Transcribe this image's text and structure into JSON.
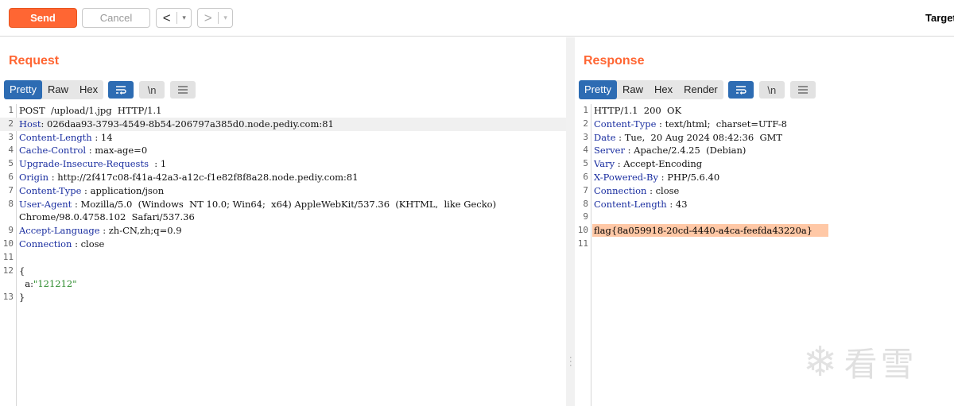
{
  "toolbar": {
    "send_label": "Send",
    "cancel_label": "Cancel",
    "back_arrow": "<",
    "forward_arrow": ">",
    "dropdown_glyph": "▾",
    "target_label": "Target"
  },
  "request": {
    "title": "Request",
    "tabs": [
      "Pretty",
      "Raw",
      "Hex"
    ],
    "active_tab": "Pretty",
    "icons": [
      "word-wrap-icon",
      "newline-icon",
      "menu-icon"
    ],
    "newline_glyph": "\\n",
    "lines": [
      {
        "num": "1",
        "segments": [
          {
            "t": "POST  /upload/1.jpg  HTTP/1.1",
            "c": "plain"
          }
        ]
      },
      {
        "num": "2",
        "highlight": true,
        "segments": [
          {
            "t": "Host",
            "c": "name"
          },
          {
            "t": ": 026daa93-3793-4549-8b54-206797a385d0.node.pediy.com:81",
            "c": "plain"
          }
        ]
      },
      {
        "num": "3",
        "segments": [
          {
            "t": "Content-Length",
            "c": "name"
          },
          {
            "t": " : 14",
            "c": "plain"
          }
        ]
      },
      {
        "num": "4",
        "segments": [
          {
            "t": "Cache-Control",
            "c": "name"
          },
          {
            "t": " : max-age=0",
            "c": "plain"
          }
        ]
      },
      {
        "num": "5",
        "segments": [
          {
            "t": "Upgrade-Insecure-Requests",
            "c": "name"
          },
          {
            "t": "  : 1",
            "c": "plain"
          }
        ]
      },
      {
        "num": "6",
        "segments": [
          {
            "t": "Origin",
            "c": "name"
          },
          {
            "t": " : http://2f417c08-f41a-42a3-a12c-f1e82f8f8a28.node.pediy.com:81",
            "c": "plain"
          }
        ]
      },
      {
        "num": "7",
        "segments": [
          {
            "t": "Content-Type",
            "c": "name"
          },
          {
            "t": " : application/json",
            "c": "plain"
          }
        ]
      },
      {
        "num": "8",
        "segments": [
          {
            "t": "User-Agent",
            "c": "name"
          },
          {
            "t": " : Mozilla/5.0  (Windows  NT 10.0; Win64;  x64) AppleWebKit/537.36  (KHTML,  like Gecko)",
            "c": "plain"
          }
        ]
      },
      {
        "num": "",
        "segments": [
          {
            "t": "Chrome/98.0.4758.102  Safari/537.36",
            "c": "plain"
          }
        ]
      },
      {
        "num": "9",
        "segments": [
          {
            "t": "Accept-Language",
            "c": "name"
          },
          {
            "t": " : zh-CN,zh;q=0.9",
            "c": "plain"
          }
        ]
      },
      {
        "num": "10",
        "segments": [
          {
            "t": "Connection",
            "c": "name"
          },
          {
            "t": " : close",
            "c": "plain"
          }
        ]
      },
      {
        "num": "11",
        "segments": []
      },
      {
        "num": "12",
        "segments": [
          {
            "t": "{",
            "c": "plain"
          }
        ]
      },
      {
        "num": "",
        "segments": [
          {
            "t": "  a:",
            "c": "plain"
          },
          {
            "t": "\"121212\"",
            "c": "string"
          }
        ]
      },
      {
        "num": "13",
        "segments": [
          {
            "t": "}",
            "c": "plain"
          }
        ]
      }
    ]
  },
  "response": {
    "title": "Response",
    "tabs": [
      "Pretty",
      "Raw",
      "Hex",
      "Render"
    ],
    "active_tab": "Pretty",
    "icons": [
      "word-wrap-icon",
      "newline-icon",
      "menu-icon"
    ],
    "newline_glyph": "\\n",
    "lines": [
      {
        "num": "1",
        "segments": [
          {
            "t": "HTTP/1.1  200  OK",
            "c": "plain"
          }
        ]
      },
      {
        "num": "2",
        "segments": [
          {
            "t": "Content-Type",
            "c": "name"
          },
          {
            "t": " : text/html;  charset=UTF-8",
            "c": "plain"
          }
        ]
      },
      {
        "num": "3",
        "segments": [
          {
            "t": "Date",
            "c": "name"
          },
          {
            "t": " : Tue,  20 Aug 2024 08:42:36  GMT",
            "c": "plain"
          }
        ]
      },
      {
        "num": "4",
        "segments": [
          {
            "t": "Server",
            "c": "name"
          },
          {
            "t": " : Apache/2.4.25  (Debian)",
            "c": "plain"
          }
        ]
      },
      {
        "num": "5",
        "segments": [
          {
            "t": "Vary",
            "c": "name"
          },
          {
            "t": " : Accept-Encoding",
            "c": "plain"
          }
        ]
      },
      {
        "num": "6",
        "segments": [
          {
            "t": "X-Powered-By",
            "c": "name"
          },
          {
            "t": " : PHP/5.6.40",
            "c": "plain"
          }
        ]
      },
      {
        "num": "7",
        "segments": [
          {
            "t": "Connection",
            "c": "name"
          },
          {
            "t": " : close",
            "c": "plain"
          }
        ]
      },
      {
        "num": "8",
        "segments": [
          {
            "t": "Content-Length",
            "c": "name"
          },
          {
            "t": " : 43",
            "c": "plain"
          }
        ]
      },
      {
        "num": "9",
        "segments": []
      },
      {
        "num": "10",
        "segments": [
          {
            "t": "flag{8a059918-20cd-4440-a4ca-feefda43220a}",
            "c": "flag"
          }
        ]
      },
      {
        "num": "11",
        "segments": []
      }
    ]
  },
  "watermark": {
    "icon": "snowflake-logo-icon",
    "text": "看雪"
  },
  "colors": {
    "accent": "#ff6633",
    "tab_active": "#2d6cb3",
    "header_name": "#1a2ea0",
    "string_value": "#2a8a2a",
    "flag_highlight": "#ffc8a6"
  }
}
